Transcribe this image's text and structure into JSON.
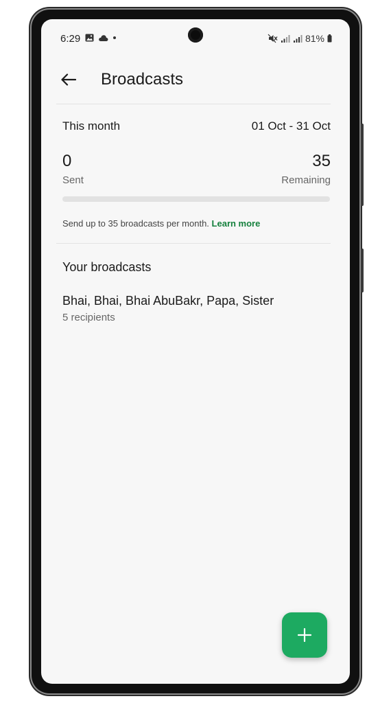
{
  "status_bar": {
    "time": "6:29",
    "battery": "81%",
    "icons": [
      "gallery-icon",
      "cloud-icon",
      "dot-icon",
      "mute-icon",
      "signal-icon",
      "signal-icon",
      "battery-icon"
    ]
  },
  "app_bar": {
    "title": "Broadcasts",
    "back_icon": "arrow-left-icon"
  },
  "period": {
    "label": "This month",
    "range": "01 Oct - 31 Oct"
  },
  "counts": {
    "sent_value": "0",
    "sent_label": "Sent",
    "remaining_value": "35",
    "remaining_label": "Remaining",
    "progress_fraction": 0
  },
  "info": {
    "text": "Send up to 35 broadcasts per month.",
    "link": "Learn more"
  },
  "broadcasts": {
    "section_title": "Your broadcasts",
    "items": [
      {
        "name": "Bhai, Bhai, Bhai AbuBakr, Papa, Sister",
        "recipients": "5 recipients"
      }
    ]
  },
  "fab": {
    "icon": "plus-icon"
  },
  "colors": {
    "accent": "#1daa61",
    "link": "#15803d",
    "track": "#e2e2e2",
    "background": "#f7f7f7"
  }
}
